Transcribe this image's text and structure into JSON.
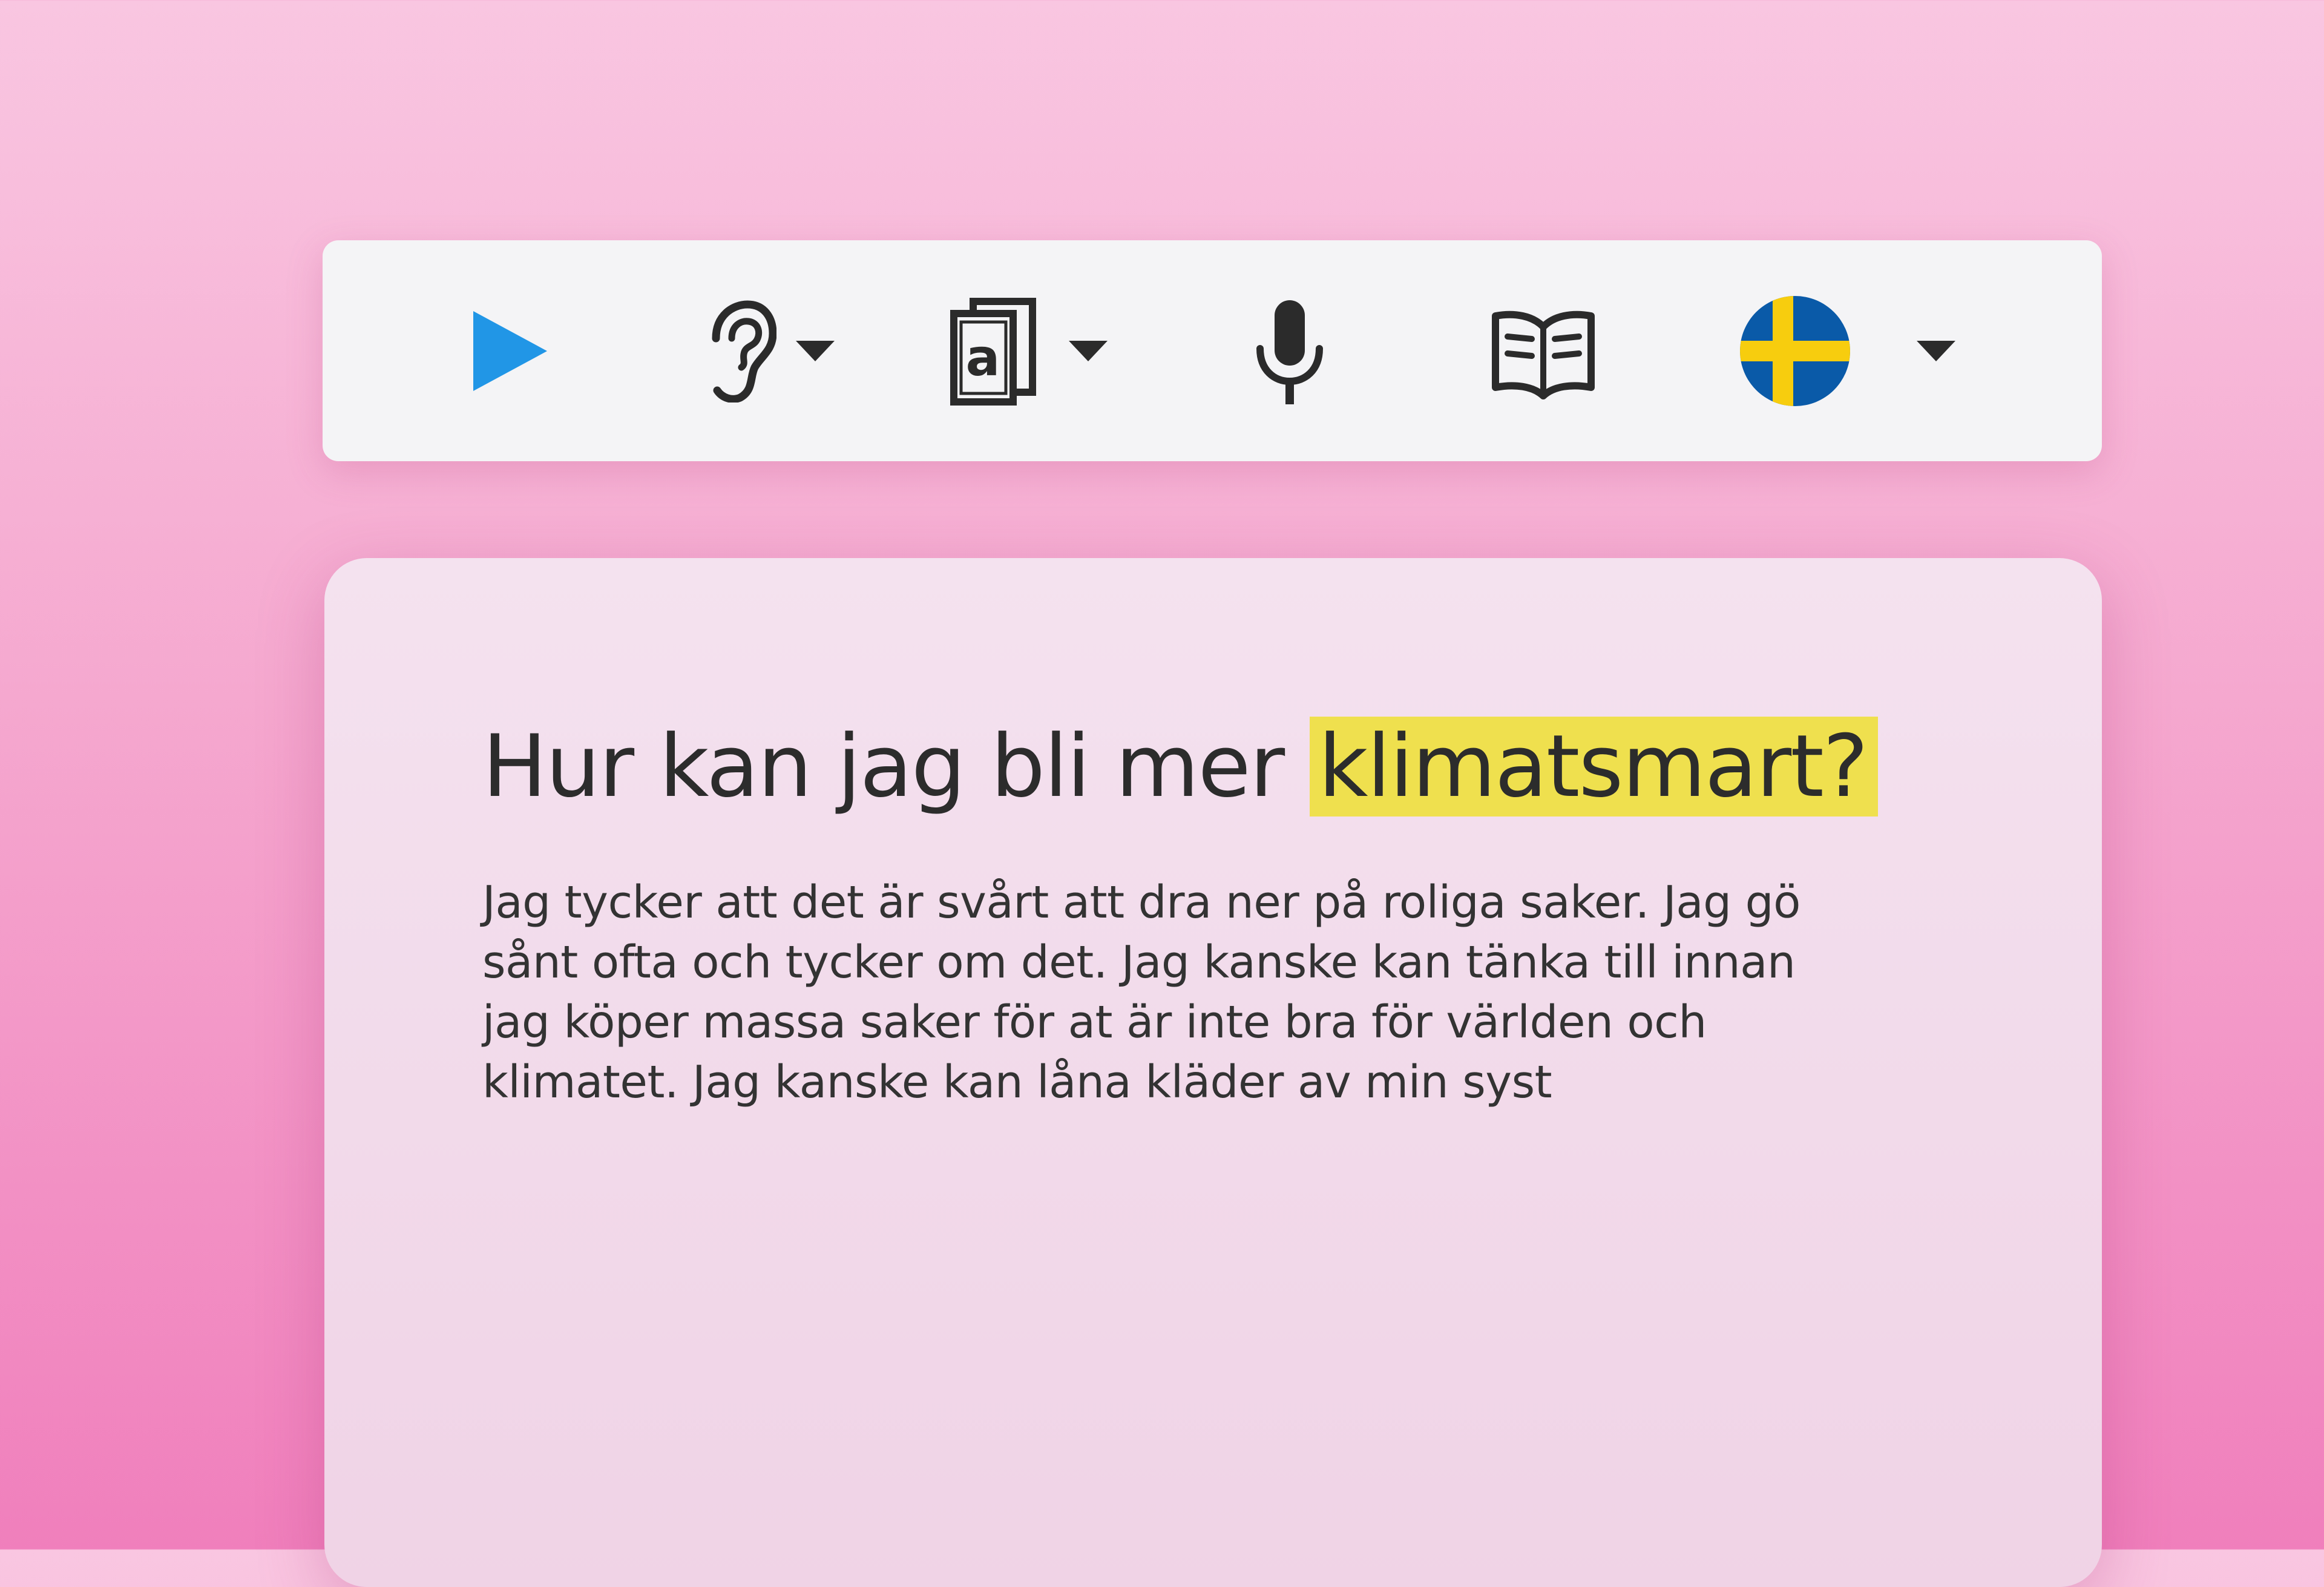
{
  "colors": {
    "play": "#2196e6",
    "icon": "#2b2b2b",
    "flag_blue": "#0a5aa8",
    "flag_yellow": "#f7cd0e",
    "highlight": "#efe04e"
  },
  "toolbar": {
    "items": [
      {
        "name": "play",
        "icon": "play-icon"
      },
      {
        "name": "listen",
        "icon": "ear-icon",
        "has_dropdown": true
      },
      {
        "name": "text-options",
        "icon": "text-pages-icon",
        "icon_text": "a",
        "has_dropdown": true
      },
      {
        "name": "dictation",
        "icon": "microphone-icon"
      },
      {
        "name": "dictionary",
        "icon": "open-book-icon"
      },
      {
        "name": "language",
        "icon": "swedish-flag-icon",
        "has_dropdown": true
      }
    ]
  },
  "card": {
    "heading_plain": "Hur kan jag bli mer ",
    "heading_highlight": "klimatsmart?",
    "body_lines": [
      "Jag tycker att det är svårt att dra ner på roliga saker. Jag gö",
      "sånt ofta och tycker om det. Jag kanske kan tänka till innan",
      "jag köper massa saker för at är inte bra för världen och",
      "klimatet. Jag kanske kan låna kläder av min syst"
    ]
  }
}
